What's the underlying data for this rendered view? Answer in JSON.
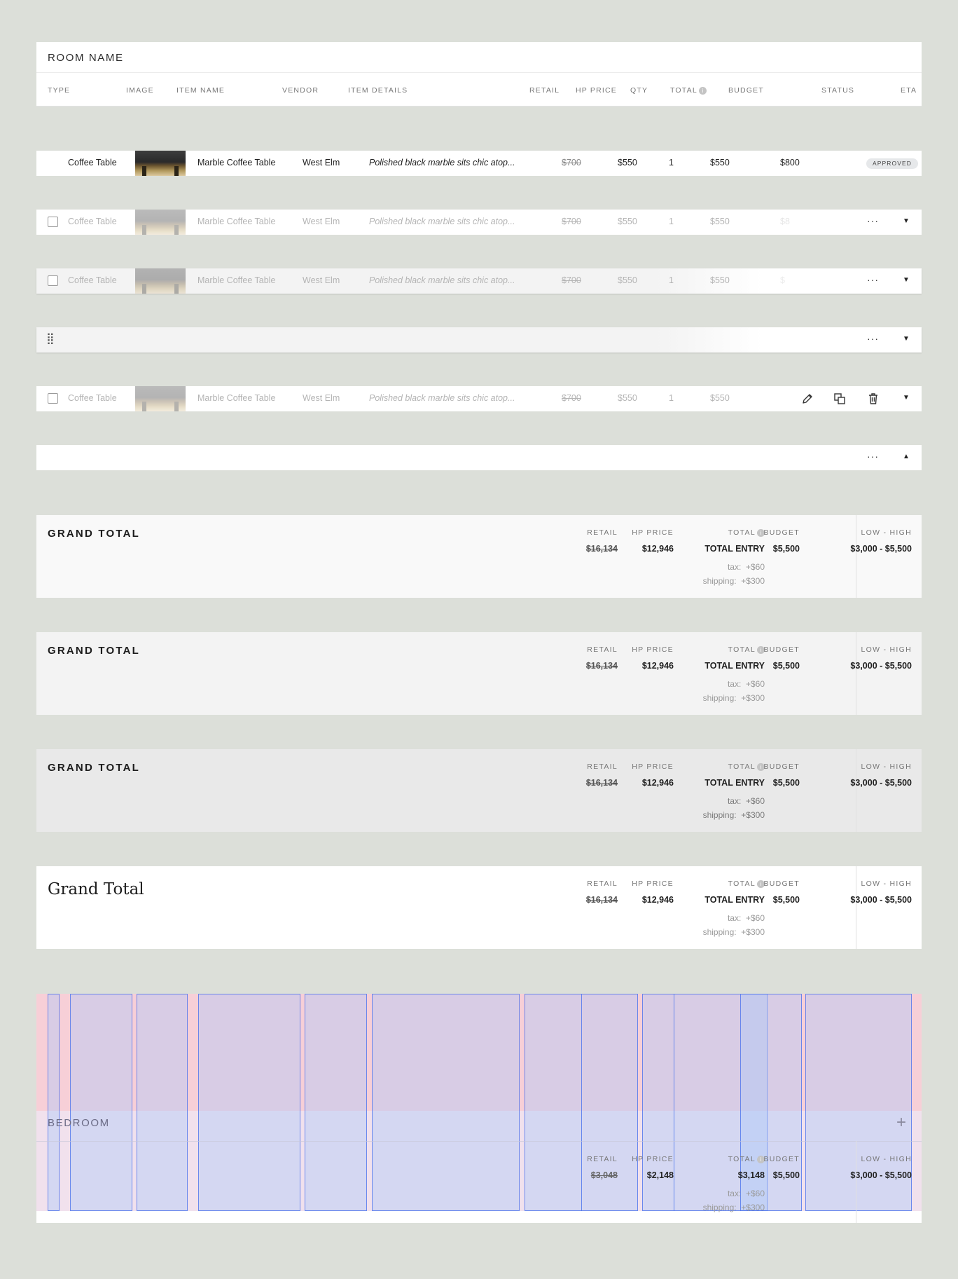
{
  "header": {
    "room_name": "ROOM NAME",
    "columns": {
      "type": "TYPE",
      "image": "IMAGE",
      "item_name": "ITEM NAME",
      "vendor": "VENDOR",
      "item_details": "ITEM DETAILS",
      "retail": "RETAIL",
      "hp_price": "HP PRICE",
      "qty": "QTY",
      "total": "TOTAL",
      "budget": "BUDGET",
      "status": "STATUS",
      "eta": "ETA"
    },
    "info_glyph": "i"
  },
  "item": {
    "type": "Coffee Table",
    "name": "Marble Coffee Table",
    "vendor": "West Elm",
    "details": "Polished black marble sits chic atop...",
    "retail": "$700",
    "hp_price": "$550",
    "qty": "1",
    "total": "$550",
    "budget": "$800",
    "budget_clipped_a": "$8",
    "budget_clipped_b": "$",
    "status": "APPROVED"
  },
  "icons": {
    "more": "···",
    "caret_down": "▼",
    "caret_up": "▲",
    "drag": "⣿",
    "plus": "+"
  },
  "grand_total": {
    "title": "GRAND TOTAL",
    "title_serif": "Grand Total",
    "labels": {
      "retail": "RETAIL",
      "hp_price": "HP PRICE",
      "total": "TOTAL",
      "budget": "BUDGET",
      "range": "LOW - HIGH"
    },
    "retail": "$16,134",
    "hp_price": "$12,946",
    "total": "TOTAL ENTRY",
    "budget": "$5,500",
    "range": "$3,000 - $5,500",
    "tax_label": "tax:",
    "tax": "+$60",
    "shipping_label": "shipping:",
    "shipping": "+$300"
  },
  "bedroom": {
    "title": "BEDROOM",
    "retail": "$3,048",
    "hp_price": "$2,148",
    "total": "$3,148",
    "budget": "$5,500",
    "range": "$3,000 - $5,500",
    "tax_label": "tax:",
    "tax": "+$60",
    "shipping_label": "shipping:",
    "shipping": "+$300"
  },
  "colors": {
    "background": "#dcdfd9",
    "card": "#ffffff",
    "total_bg_1": "#f9f9f9",
    "total_bg_2": "#f3f3f3",
    "total_bg_3": "#e9e9e9",
    "badge_bg": "#e6e8ea",
    "grid_pink": "#eb8ca0",
    "grid_blue": "#466eeb"
  }
}
